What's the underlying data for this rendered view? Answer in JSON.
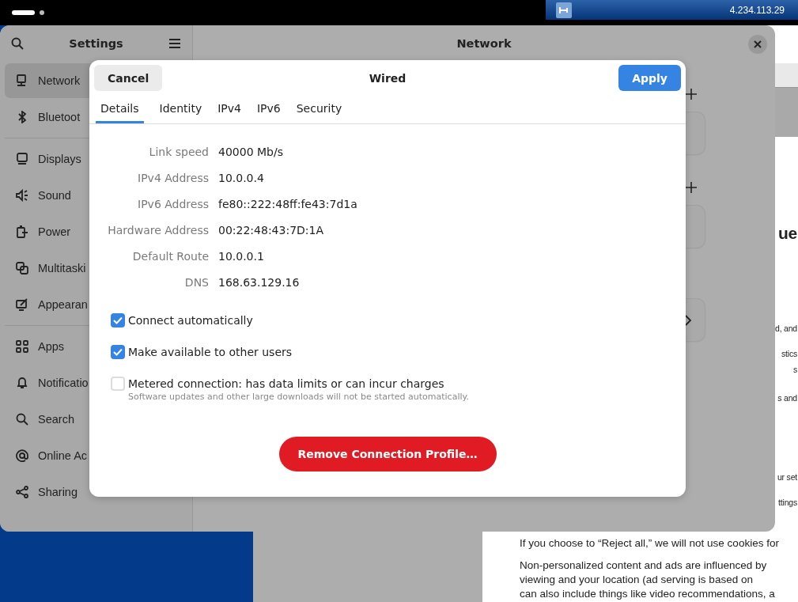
{
  "top_bar": {
    "address": "4.234.113.29"
  },
  "settings": {
    "sidebar_title": "Settings",
    "title": "Network",
    "sidebar_groups": [
      [
        {
          "label": "Network",
          "selected": true
        },
        {
          "label": "Bluetoot",
          "selected": false
        }
      ],
      [
        {
          "label": "Displays",
          "selected": false
        },
        {
          "label": "Sound",
          "selected": false
        },
        {
          "label": "Power",
          "selected": false
        },
        {
          "label": "Multitaski",
          "selected": false
        },
        {
          "label": "Appearan",
          "selected": false
        }
      ],
      [
        {
          "label": "Apps",
          "selected": false
        },
        {
          "label": "Notificatio",
          "selected": false
        },
        {
          "label": "Search",
          "selected": false
        },
        {
          "label": "Online Ac",
          "selected": false
        },
        {
          "label": "Sharing",
          "selected": false
        }
      ]
    ]
  },
  "dialog": {
    "title": "Wired",
    "cancel": "Cancel",
    "apply": "Apply",
    "tabs": [
      {
        "label": "Details",
        "selected": true
      },
      {
        "label": "Identity",
        "selected": false
      },
      {
        "label": "IPv4",
        "selected": false
      },
      {
        "label": "IPv6",
        "selected": false
      },
      {
        "label": "Security",
        "selected": false
      }
    ],
    "details": [
      {
        "label": "Link speed",
        "value": "40000 Mb/s"
      },
      {
        "label": "IPv4 Address",
        "value": "10.0.0.4"
      },
      {
        "label": "IPv6 Address",
        "value": "fe80::222:48ff:fe43:7d1a"
      },
      {
        "label": "Hardware Address",
        "value": "00:22:48:43:7D:1A"
      },
      {
        "label": "Default Route",
        "value": "10.0.0.1"
      },
      {
        "label": "DNS",
        "value": "168.63.129.16"
      }
    ],
    "options": [
      {
        "label": "Connect automatically",
        "checked": true
      },
      {
        "label": "Make available to other users",
        "checked": true
      },
      {
        "label": "Metered connection: has data limits or can incur charges",
        "checked": false,
        "hint": "Software updates and other large downloads will not be started automatically."
      }
    ],
    "remove": "Remove Connection Profile…"
  },
  "browser": {
    "strip": [
      {
        "text": "ue",
        "kind": "heading"
      },
      {
        "text": "d, and",
        "kind": "text"
      },
      {
        "text": "stics",
        "kind": "text"
      },
      {
        "text": "s",
        "kind": "text"
      },
      {
        "text": "s and",
        "kind": "text"
      },
      {
        "text": "ur set",
        "kind": "text"
      },
      {
        "text": "ttings",
        "kind": "text"
      }
    ],
    "paragraphs": [
      "If you choose to “Reject all,” we will not use cookies for",
      "Non-personalized content and ads are influenced by\nviewing and your location (ad serving is based on\ncan also include things like video recommendations, a"
    ]
  }
}
